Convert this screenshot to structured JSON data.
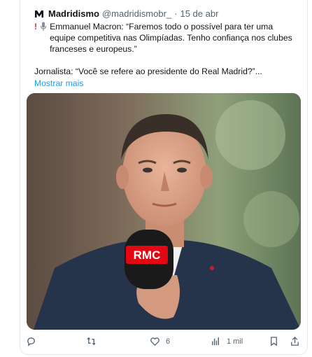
{
  "tweet": {
    "author_name": "Madridismo",
    "handle": "@madridismobr_",
    "separator": "·",
    "date": "15 de abr",
    "emphasis": "!",
    "paragraph1": "Emmanuel Macron: “Faremos todo o possível para ter uma equipe competitiva nas Olimpíadas. Tenho confiança nos clubes franceses e europeus.”",
    "paragraph2": "Jornalista: “Você se refere ao presidente do Real Madrid?”...",
    "show_more": "Mostrar mais",
    "media": {
      "microphone_brand": "RMC",
      "brand_color": "#e30613"
    }
  },
  "actions": {
    "reply_count": "",
    "retweet_count": "",
    "like_count": "6",
    "views_count": "1 mil"
  },
  "colors": {
    "link": "#1d9bf0",
    "muted": "#536471",
    "text": "#0f1419"
  }
}
